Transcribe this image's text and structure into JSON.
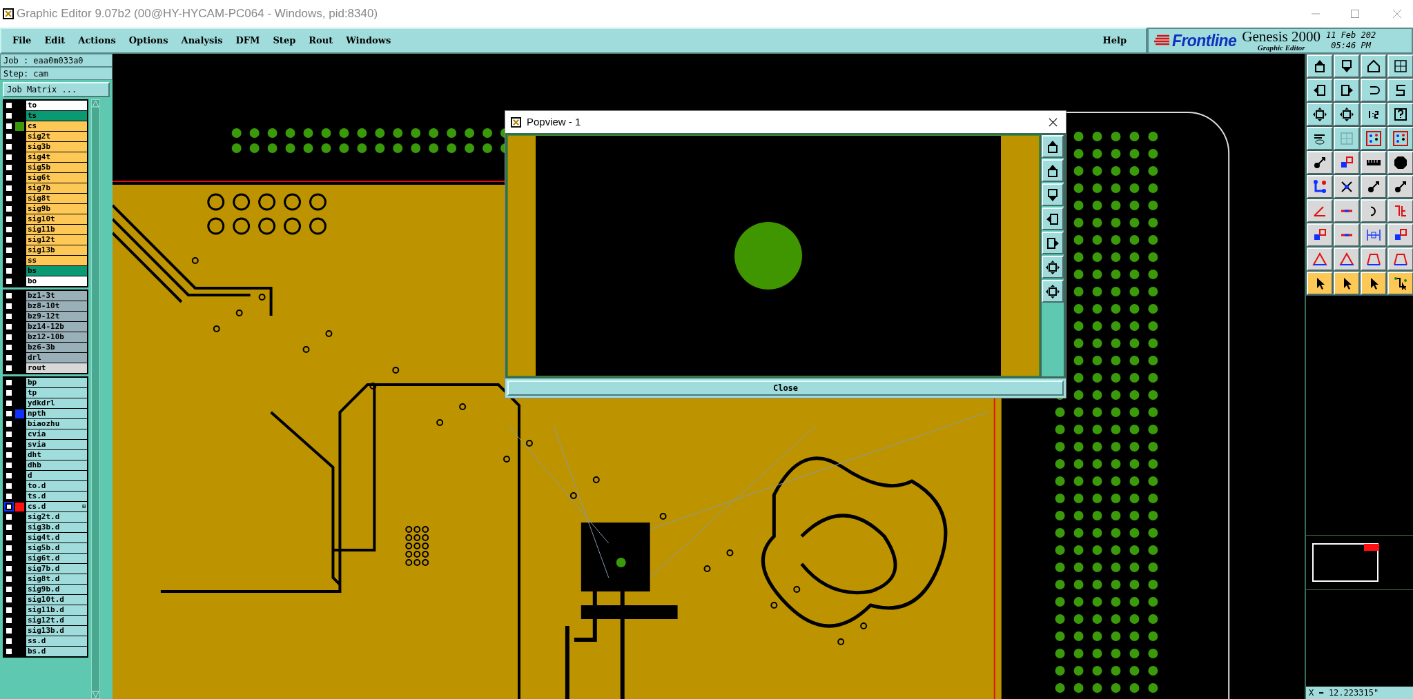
{
  "window": {
    "title": "Graphic Editor 9.07b2 (00@HY-HYCAM-PC064 - Windows, pid:8340)"
  },
  "menu": [
    "File",
    "Edit",
    "Actions",
    "Options",
    "Analysis",
    "DFM",
    "Step",
    "Rout",
    "Windows"
  ],
  "help": "Help",
  "brand": {
    "logo": "Frontline",
    "product": "Genesis 2000",
    "subtitle": "Graphic Editor",
    "date": "11 Feb 202",
    "time": "05:46 PM"
  },
  "job": {
    "job": "Job : eaa0m033a0",
    "step": "Step: cam",
    "matrix_button": "Job Matrix ..."
  },
  "layer_groups": [
    {
      "layers": [
        {
          "name": "to",
          "kind": "overlay",
          "selected": false
        },
        {
          "name": "ts",
          "kind": "mask",
          "selected": false
        },
        {
          "name": "cs",
          "kind": "signal",
          "selected": false,
          "color": "#3a9a0a"
        },
        {
          "name": "sig2t",
          "kind": "signal",
          "selected": false
        },
        {
          "name": "sig3b",
          "kind": "signal",
          "selected": false
        },
        {
          "name": "sig4t",
          "kind": "signal",
          "selected": false
        },
        {
          "name": "sig5b",
          "kind": "signal",
          "selected": false
        },
        {
          "name": "sig6t",
          "kind": "signal",
          "selected": false
        },
        {
          "name": "sig7b",
          "kind": "signal",
          "selected": false
        },
        {
          "name": "sig8t",
          "kind": "signal",
          "selected": false
        },
        {
          "name": "sig9b",
          "kind": "signal",
          "selected": false
        },
        {
          "name": "sig10t",
          "kind": "signal",
          "selected": false
        },
        {
          "name": "sig11b",
          "kind": "signal",
          "selected": false
        },
        {
          "name": "sig12t",
          "kind": "signal",
          "selected": false
        },
        {
          "name": "sig13b",
          "kind": "signal",
          "selected": false
        },
        {
          "name": "ss",
          "kind": "signal",
          "selected": false
        },
        {
          "name": "bs",
          "kind": "mask",
          "selected": false
        },
        {
          "name": "bo",
          "kind": "overlay",
          "selected": false
        }
      ]
    },
    {
      "layers": [
        {
          "name": "bz1-3t",
          "kind": "drill",
          "selected": false
        },
        {
          "name": "bz8-10t",
          "kind": "drill",
          "selected": false
        },
        {
          "name": "bz9-12t",
          "kind": "drill",
          "selected": false
        },
        {
          "name": "bz14-12b",
          "kind": "drill",
          "selected": false
        },
        {
          "name": "bz12-10b",
          "kind": "drill",
          "selected": false
        },
        {
          "name": "bz6-3b",
          "kind": "drill",
          "selected": false
        },
        {
          "name": "drl",
          "kind": "drill",
          "selected": false
        },
        {
          "name": "rout",
          "kind": "rout",
          "selected": false
        }
      ]
    },
    {
      "layers": [
        {
          "name": "bp",
          "kind": "document",
          "selected": false
        },
        {
          "name": "tp",
          "kind": "document",
          "selected": false
        },
        {
          "name": "ydkdrl",
          "kind": "document",
          "selected": false
        },
        {
          "name": "npth",
          "kind": "document",
          "selected": false,
          "color": "#1030ff"
        },
        {
          "name": "biaozhu",
          "kind": "document",
          "selected": false
        },
        {
          "name": "cvia",
          "kind": "document",
          "selected": false
        },
        {
          "name": "svia",
          "kind": "document",
          "selected": false
        },
        {
          "name": "dht",
          "kind": "document",
          "selected": false
        },
        {
          "name": "dhb",
          "kind": "document",
          "selected": false
        },
        {
          "name": "d",
          "kind": "document",
          "selected": false
        },
        {
          "name": "to.d",
          "kind": "document",
          "selected": false
        },
        {
          "name": "ts.d",
          "kind": "document",
          "selected": false
        },
        {
          "name": "cs.d",
          "kind": "document",
          "selected": true,
          "color": "#ff1010",
          "expand_mark": "⊞"
        },
        {
          "name": "sig2t.d",
          "kind": "document",
          "selected": false
        },
        {
          "name": "sig3b.d",
          "kind": "document",
          "selected": false
        },
        {
          "name": "sig4t.d",
          "kind": "document",
          "selected": false
        },
        {
          "name": "sig5b.d",
          "kind": "document",
          "selected": false
        },
        {
          "name": "sig6t.d",
          "kind": "document",
          "selected": false
        },
        {
          "name": "sig7b.d",
          "kind": "document",
          "selected": false
        },
        {
          "name": "sig8t.d",
          "kind": "document",
          "selected": false
        },
        {
          "name": "sig9b.d",
          "kind": "document",
          "selected": false
        },
        {
          "name": "sig10t.d",
          "kind": "document",
          "selected": false
        },
        {
          "name": "sig11b.d",
          "kind": "document",
          "selected": false
        },
        {
          "name": "sig12t.d",
          "kind": "document",
          "selected": false
        },
        {
          "name": "sig13b.d",
          "kind": "document",
          "selected": false
        },
        {
          "name": "ss.d",
          "kind": "document",
          "selected": false
        },
        {
          "name": "bs.d",
          "kind": "document",
          "selected": false
        }
      ]
    }
  ],
  "popview": {
    "title": "Popview - 1",
    "close_button": "Close"
  },
  "status": {
    "coordinate": "X = 12.223315\""
  }
}
